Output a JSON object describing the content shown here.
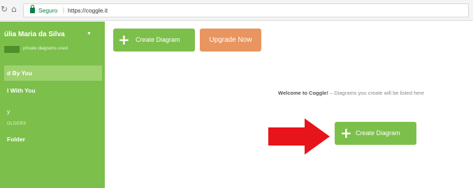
{
  "browser": {
    "secure_label": "Seguro",
    "url": "https://coggle.it"
  },
  "sidebar": {
    "user_name": "úlia Maria da Silva",
    "usage_badge": "",
    "usage_text": "private diagrams used",
    "items": [
      {
        "label": "d By You",
        "active": true
      },
      {
        "label": "l With You"
      },
      {
        "label": "y"
      },
      {
        "label": "Folder"
      }
    ],
    "section_label": "OLDERS"
  },
  "toolbar": {
    "create_label": "Create Diagram",
    "upgrade_label": "Upgrade Now"
  },
  "main": {
    "welcome_bold": "Welcome to Coggle!",
    "welcome_rest": " – Diagrams you create will be listed here",
    "create_label": "Create Diagram"
  },
  "colors": {
    "sidebar_green": "#7cc04b",
    "upgrade_orange": "#e9955f",
    "arrow_red": "#e8141b"
  }
}
